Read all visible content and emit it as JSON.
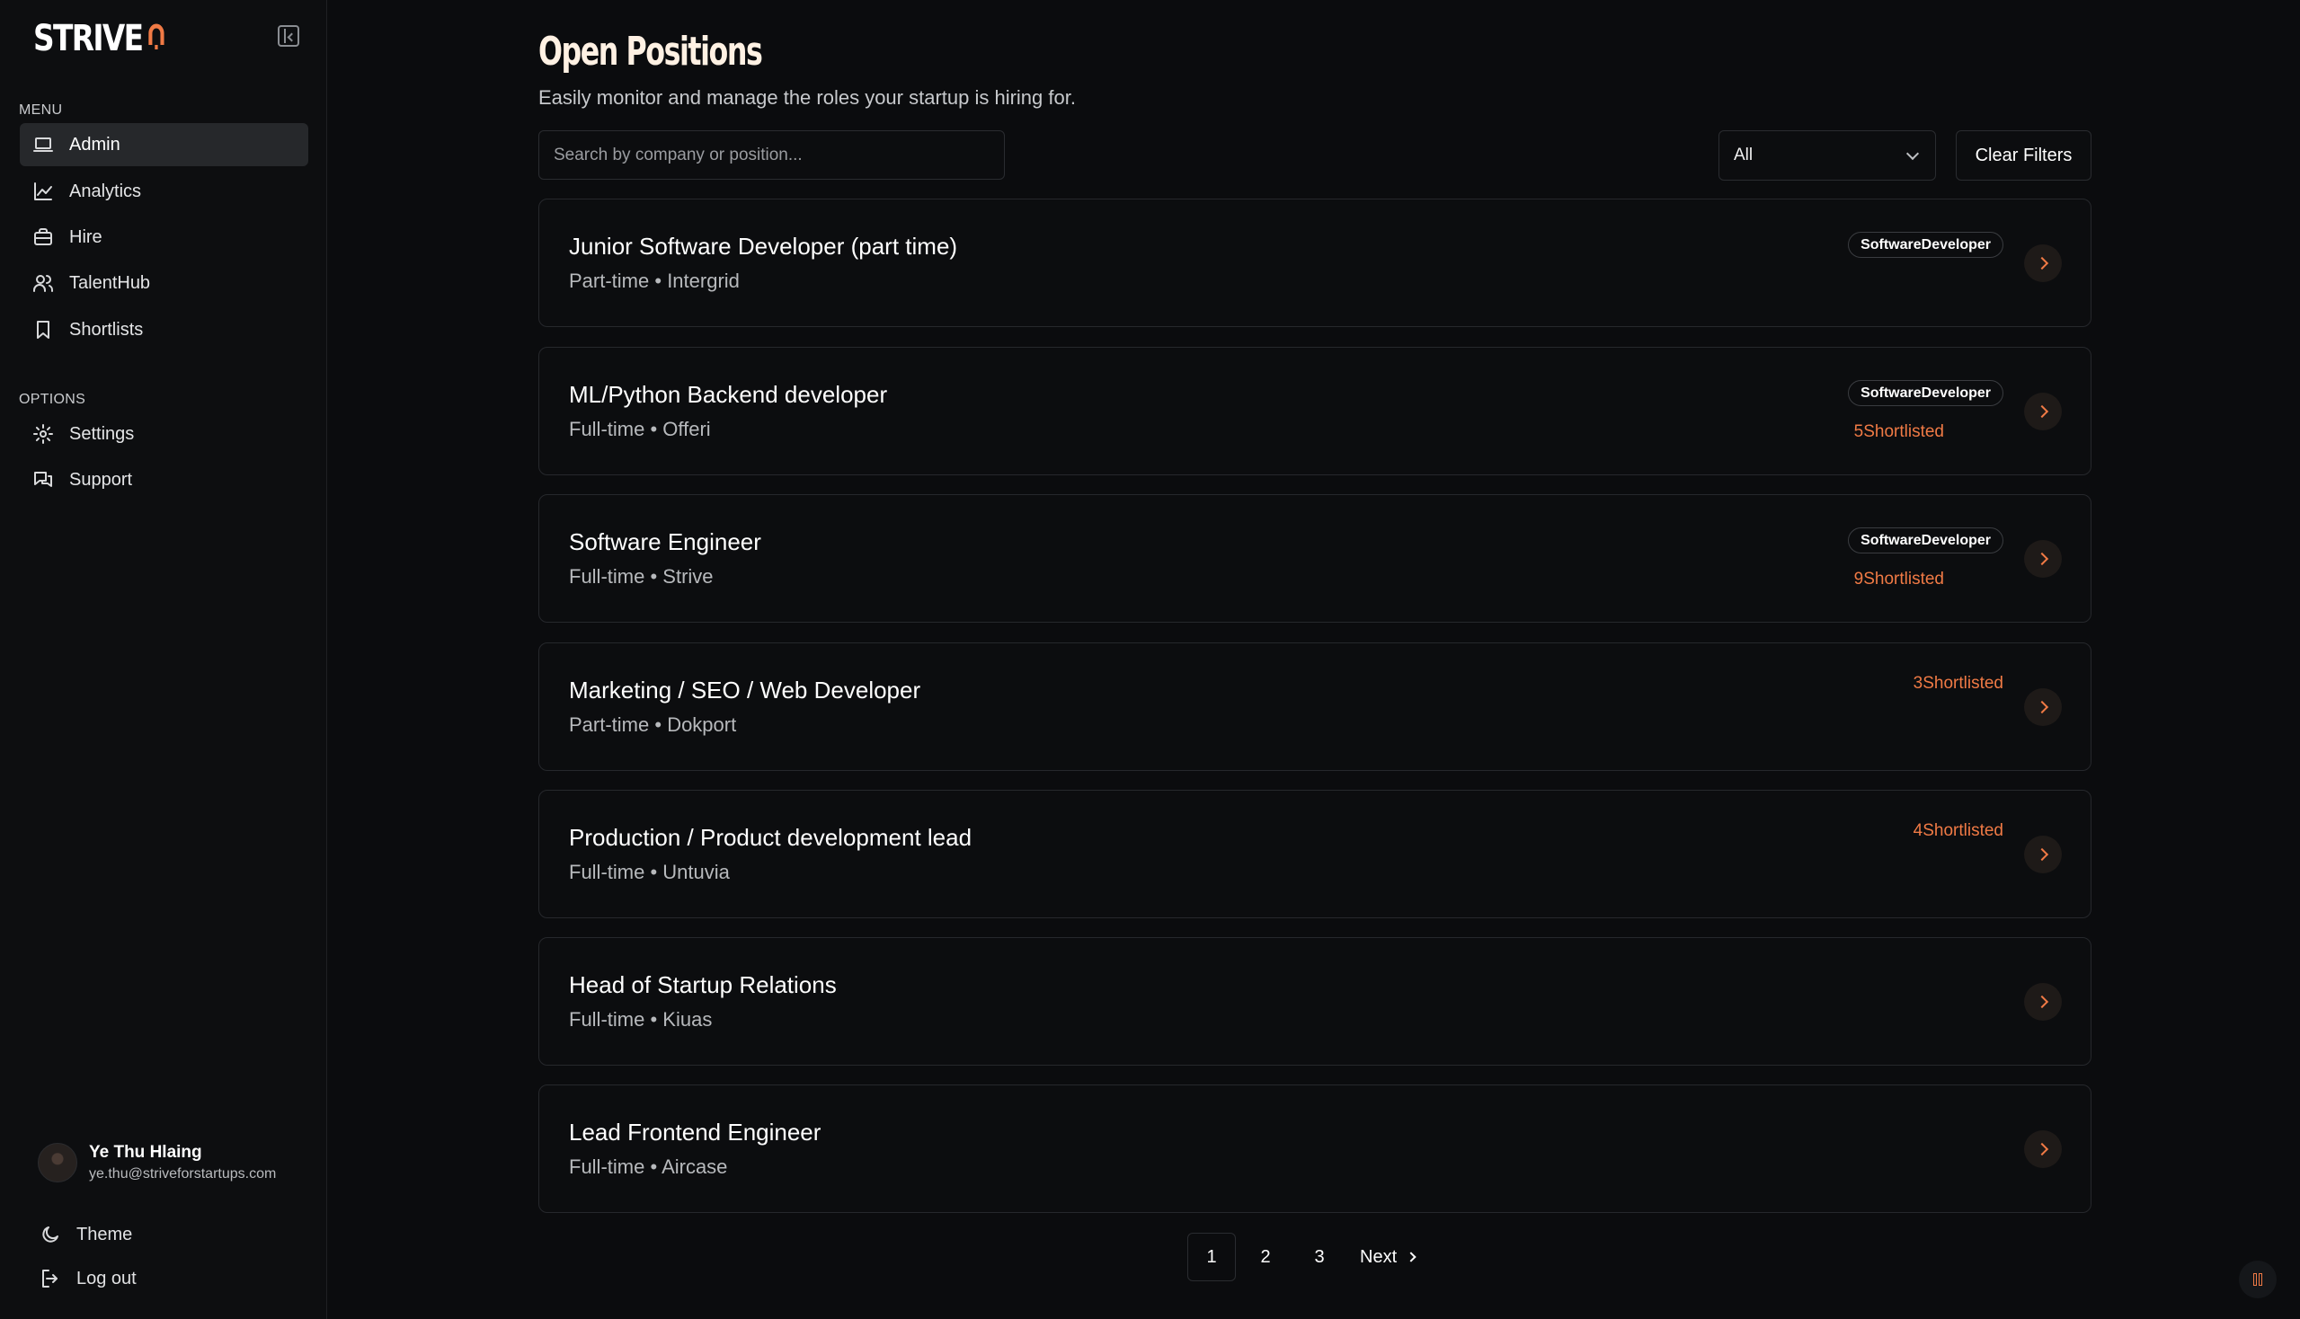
{
  "brand": {
    "name": "STRIVE",
    "accent": "#f07a45"
  },
  "sidebar": {
    "menu_label": "MENU",
    "menu_items": [
      {
        "label": "Admin",
        "icon": "laptop-icon",
        "active": true
      },
      {
        "label": "Analytics",
        "icon": "chart-line-icon",
        "active": false
      },
      {
        "label": "Hire",
        "icon": "briefcase-icon",
        "active": false
      },
      {
        "label": "TalentHub",
        "icon": "users-icon",
        "active": false
      },
      {
        "label": "Shortlists",
        "icon": "bookmark-icon",
        "active": false
      }
    ],
    "options_label": "OPTIONS",
    "option_items": [
      {
        "label": "Settings",
        "icon": "gear-icon"
      },
      {
        "label": "Support",
        "icon": "messages-icon"
      }
    ],
    "user": {
      "name": "Ye Thu Hlaing",
      "email": "ye.thu@striveforstartups.com"
    },
    "utility": [
      {
        "label": "Theme",
        "icon": "moon-icon"
      },
      {
        "label": "Log out",
        "icon": "logout-icon"
      }
    ]
  },
  "main": {
    "title": "Open Positions",
    "subtitle": "Easily monitor and manage the roles your startup is hiring for.",
    "search_placeholder": "Search by company or position...",
    "filter_value": "All",
    "clear_label": "Clear Filters",
    "jobs": [
      {
        "title": "Junior Software Developer (part time)",
        "type": "Part-time",
        "company": "Intergrid",
        "tag": "SoftwareDeveloper",
        "shortlisted": ""
      },
      {
        "title": "ML/Python Backend developer",
        "type": "Full-time",
        "company": "Offeri",
        "tag": "SoftwareDeveloper",
        "shortlisted": "5Shortlisted"
      },
      {
        "title": "Software Engineer",
        "type": "Full-time",
        "company": "Strive",
        "tag": "SoftwareDeveloper",
        "shortlisted": "9Shortlisted"
      },
      {
        "title": "Marketing / SEO / Web Developer",
        "type": "Part-time",
        "company": "Dokport",
        "tag": "",
        "shortlisted": "3Shortlisted"
      },
      {
        "title": "Production / Product development lead",
        "type": "Full-time",
        "company": "Untuvia",
        "tag": "",
        "shortlisted": "4Shortlisted"
      },
      {
        "title": "Head of Startup Relations",
        "type": "Full-time",
        "company": "Kiuas",
        "tag": "",
        "shortlisted": ""
      },
      {
        "title": "Lead Frontend Engineer",
        "type": "Full-time",
        "company": "Aircase",
        "tag": "",
        "shortlisted": ""
      }
    ],
    "pagination": {
      "pages": [
        "1",
        "2",
        "3"
      ],
      "current": "1",
      "next_label": "Next"
    }
  }
}
